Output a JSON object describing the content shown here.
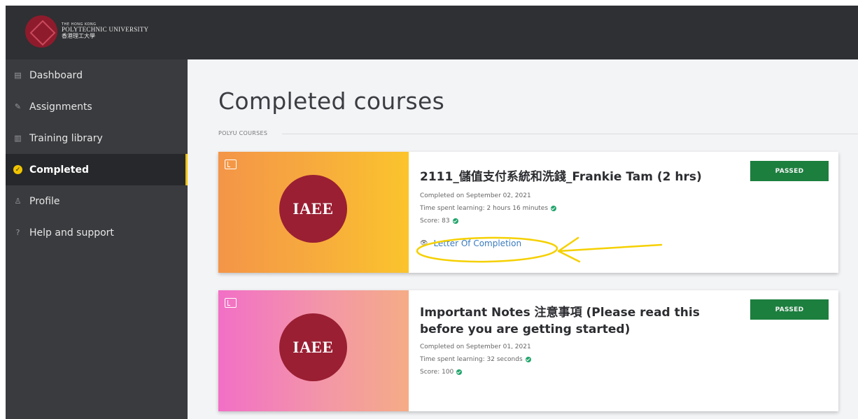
{
  "brand": {
    "line1": "THE HONG KONG",
    "line2": "POLYTECHNIC UNIVERSITY",
    "line3": "香港理工大學"
  },
  "sidebar": {
    "items": [
      {
        "label": "Dashboard",
        "icon": "dashboard-icon",
        "glyph": "▤"
      },
      {
        "label": "Assignments",
        "icon": "assignments-icon",
        "glyph": "✎"
      },
      {
        "label": "Training library",
        "icon": "library-icon",
        "glyph": "▥"
      },
      {
        "label": "Completed",
        "icon": "completed-icon",
        "glyph": "✓",
        "active": true
      },
      {
        "label": "Profile",
        "icon": "profile-icon",
        "glyph": "♙"
      },
      {
        "label": "Help and support",
        "icon": "help-icon",
        "glyph": "?"
      }
    ]
  },
  "main": {
    "title": "Completed courses",
    "section_label": "POLYU COURSES",
    "courses": [
      {
        "badge": "IAEE",
        "title": "2111_儲值支付系統和洗錢_Frankie Tam (2 hrs)",
        "completed": "Completed on September 02, 2021",
        "time": "Time spent learning: 2 hours 16 minutes",
        "score": "Score: 83",
        "status": "PASSED",
        "letter_link": "Letter Of Completion"
      },
      {
        "badge": "IAEE",
        "title": "Important Notes 注意事項 (Please read this before you are getting started)",
        "completed": "Completed on September 01, 2021",
        "time": "Time spent learning: 32 seconds",
        "score": "Score: 100",
        "status": "PASSED"
      }
    ]
  },
  "colors": {
    "accent": "#f1c400",
    "passed": "#1c7f3e",
    "brand": "#9a1f33",
    "annotation": "#f5d000"
  }
}
